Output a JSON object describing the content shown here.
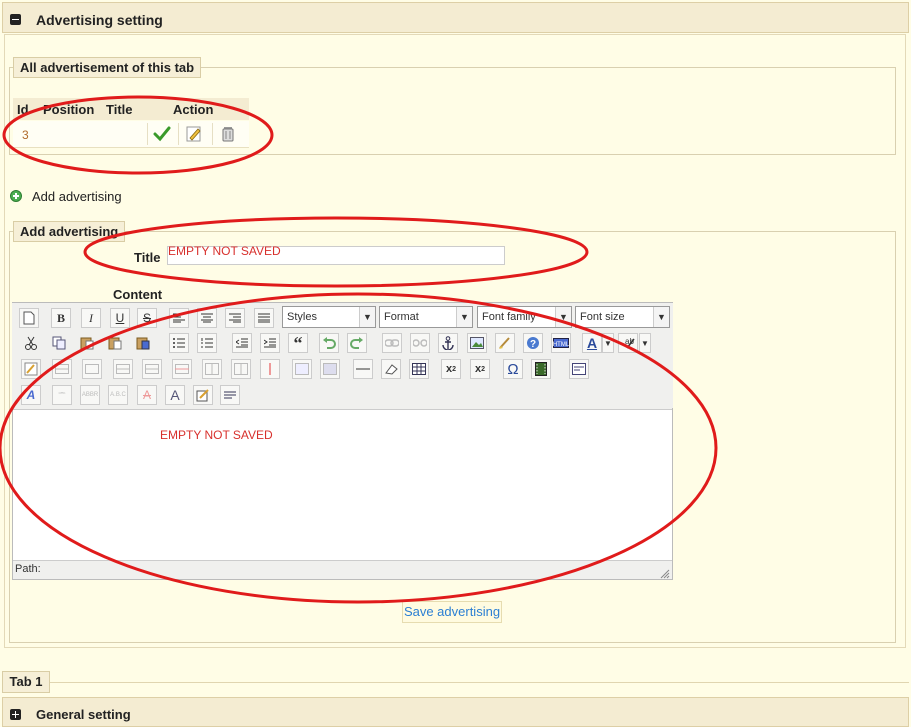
{
  "header": {
    "title": "Advertising setting",
    "toggle_icon": "collapse-icon"
  },
  "ads_list": {
    "legend": "All advertisement of this tab",
    "columns": [
      "Id",
      "Position",
      "Title",
      "Action"
    ],
    "rows": [
      {
        "id": "3",
        "position": "",
        "title": "",
        "actions": [
          "check-icon",
          "edit-icon",
          "delete-icon"
        ]
      }
    ]
  },
  "add_link": {
    "label": "Add advertising"
  },
  "add_form": {
    "legend": "Add advertising",
    "title_label": "Title",
    "title_value": "",
    "content_label": "Content",
    "editor": {
      "styles": "Styles",
      "format": "Format",
      "font_family": "Font family",
      "font_size": "Font size",
      "path_label": "Path:"
    },
    "save_label": "Save advertising"
  },
  "annotations": {
    "title_note": "EMPTY NOT SAVED",
    "content_note": "EMPTY NOT SAVED",
    "color": "#d8302c"
  },
  "tabs": {
    "tab1_label": "Tab 1"
  },
  "general": {
    "title": "General setting",
    "toggle_icon": "expand-icon"
  }
}
